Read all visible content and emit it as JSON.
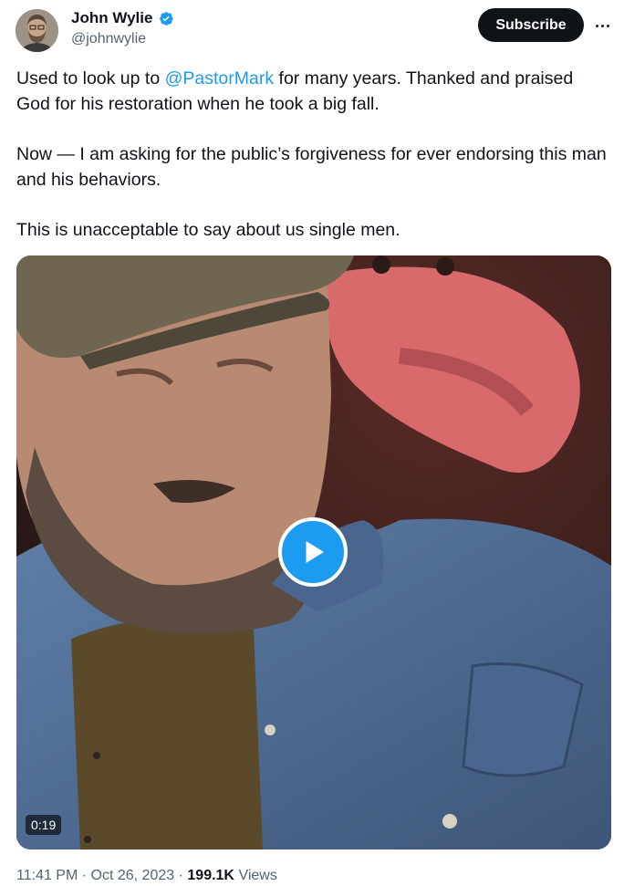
{
  "author": {
    "display_name": "John Wylie",
    "handle": "@johnwylie",
    "verified": true
  },
  "actions": {
    "subscribe_label": "Subscribe",
    "more_icon": "more-horizontal-icon"
  },
  "tweet": {
    "line1_before": "Used to look up to ",
    "mention": "@PastorMark",
    "line1_after": " for many years. Thanked and praised God for his restoration when he took a big fall.",
    "paragraph2": "Now — I am asking for the public’s forgiveness for ever endorsing this man and his behaviors.",
    "paragraph3": "This is unacceptable to say about us single men."
  },
  "media": {
    "type": "video",
    "duration": "0:19",
    "play_icon": "play-icon"
  },
  "meta": {
    "time": "11:41 PM",
    "separator": "·",
    "date": "Oct 26, 2023",
    "views_count": "199.1K",
    "views_label": "Views"
  },
  "colors": {
    "accent": "#1d9bf0",
    "text": "#0f1419",
    "muted": "#536471"
  }
}
